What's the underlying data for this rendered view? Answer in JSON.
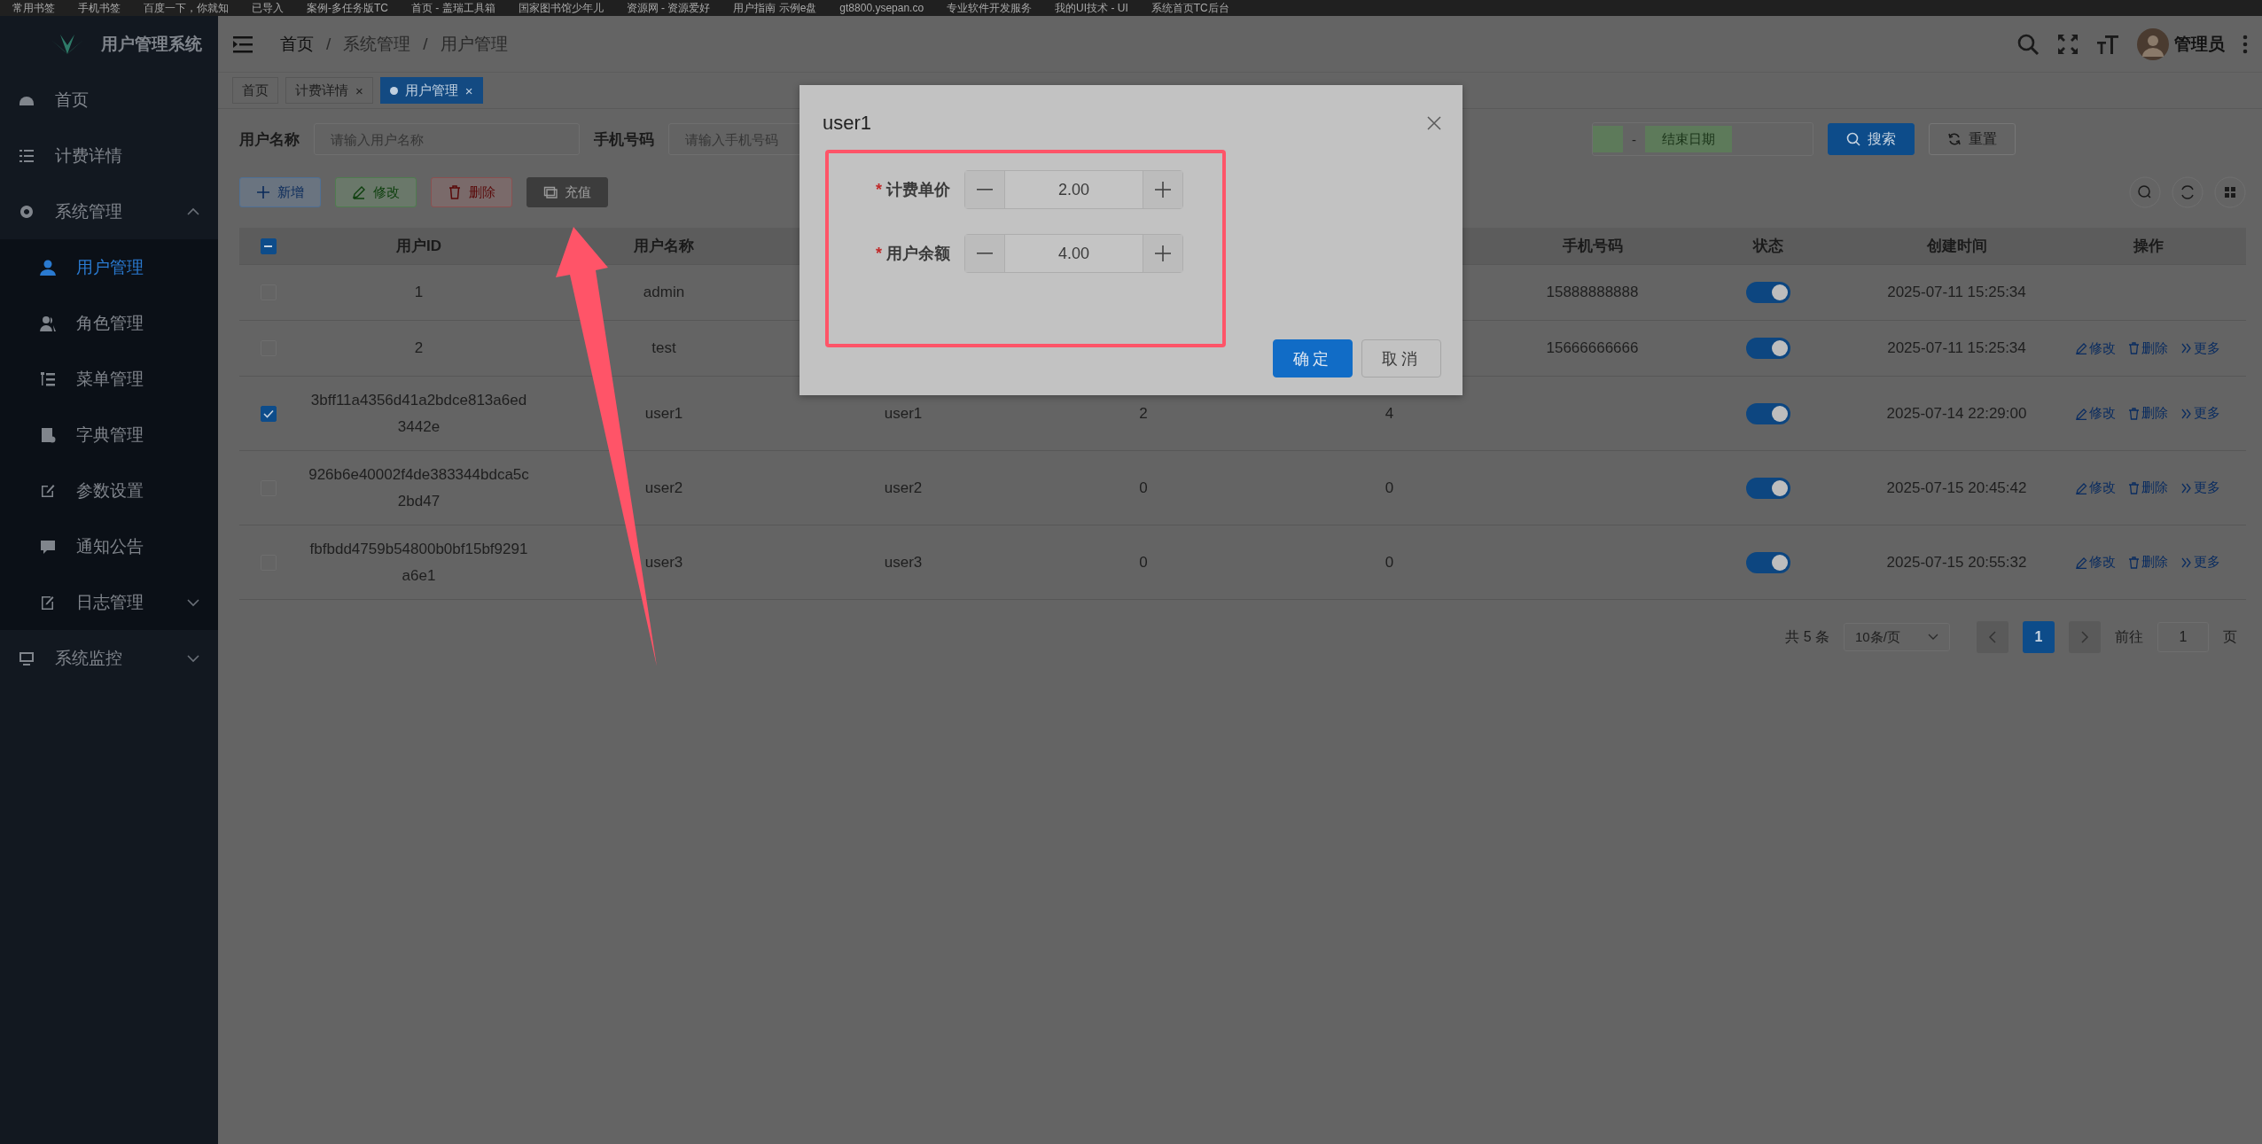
{
  "bookmarks": [
    "常用书签",
    "手机书签",
    "百度一下，你就知",
    "已导入",
    "案例-多任务版TC",
    "首页 - 盖瑞工具箱",
    "国家图书馆少年儿",
    "资源网 - 资源爱好",
    "用户指南 示例e盘",
    "gt8800.ysepan.co",
    "专业软件开发服务",
    "我的UI技术 - UI",
    "系统首页TC后台"
  ],
  "sidebar": {
    "title": "用户管理系统",
    "items": [
      {
        "label": "首页",
        "selected": false
      },
      {
        "label": "计费详情",
        "selected": false
      },
      {
        "label": "系统管理",
        "selected": false,
        "expanded": true,
        "children": [
          {
            "label": "用户管理",
            "selected": true
          },
          {
            "label": "角色管理",
            "selected": false
          },
          {
            "label": "菜单管理",
            "selected": false
          },
          {
            "label": "字典管理",
            "selected": false
          },
          {
            "label": "参数设置",
            "selected": false
          },
          {
            "label": "通知公告",
            "selected": false
          },
          {
            "label": "日志管理",
            "selected": false,
            "expanded": false
          }
        ]
      },
      {
        "label": "系统监控",
        "selected": false,
        "expanded": false
      }
    ]
  },
  "header": {
    "breadcrumb": [
      {
        "label": "首页"
      },
      {
        "separator": "/",
        "label": "系统管理"
      },
      {
        "separator": "/",
        "label": "用户管理"
      }
    ],
    "user": "管理员"
  },
  "tabs": [
    {
      "label": "首页",
      "selected": false
    },
    {
      "label": "计费详情",
      "selected": false,
      "close": "×"
    },
    {
      "label": "用户管理",
      "selected": true,
      "close": "×"
    }
  ],
  "search_form": {
    "fields": [
      {
        "label": "用户名称",
        "placeholder": "请输入用户名称"
      },
      {
        "label": "手机号码",
        "placeholder": "请输入手机号码"
      }
    ],
    "date_separator": "-",
    "date_end_placeholder": "结束日期",
    "buttons": [
      {
        "label": "搜索",
        "kind": "primary"
      },
      {
        "label": "重置",
        "kind": "default"
      }
    ]
  },
  "toolbar": [
    {
      "label": "新增",
      "kind": "add"
    },
    {
      "label": "修改",
      "kind": "edit"
    },
    {
      "label": "删除",
      "kind": "delete"
    },
    {
      "label": "充值",
      "kind": "recharge"
    }
  ],
  "table": {
    "header_checkbox": {
      "indeterminate": true
    },
    "columns": {
      "id": "用户ID",
      "name": "用户名称",
      "phone": "手机号码",
      "status": "状态",
      "created": "创建时间",
      "actions": "操作"
    },
    "rows": [
      {
        "checked": false,
        "id": "1",
        "name": "admin",
        "phone": "15888888888",
        "status_on": true,
        "created": "2025-07-11 15:25:34"
      },
      {
        "checked": false,
        "id": "2",
        "name": "test",
        "phone": "15666666666",
        "status_on": true,
        "created": "2025-07-11 15:25:34",
        "actions": [
          {
            "kind": "edit",
            "label": "修改"
          },
          {
            "kind": "delete",
            "label": "删除"
          },
          {
            "kind": "more",
            "label": "更多"
          }
        ]
      },
      {
        "checked": true,
        "id": "3bff11a4356d41a2bdce813a6ed3442e",
        "name": "user1",
        "column_3": "user1",
        "column_4": "2",
        "column_5": "4",
        "status_on": true,
        "created": "2025-07-14 22:29:00",
        "actions": [
          {
            "kind": "edit",
            "label": "修改"
          },
          {
            "kind": "delete",
            "label": "删除"
          },
          {
            "kind": "more",
            "label": "更多"
          }
        ]
      },
      {
        "checked": false,
        "id": "926b6e40002f4de383344bdca5c2bd47",
        "name": "user2",
        "column_3": "user2",
        "column_4": "0",
        "column_5": "0",
        "status_on": true,
        "created": "2025-07-15 20:45:42",
        "actions": [
          {
            "kind": "edit",
            "label": "修改"
          },
          {
            "kind": "delete",
            "label": "删除"
          },
          {
            "kind": "more",
            "label": "更多"
          }
        ]
      },
      {
        "checked": false,
        "id": "fbfbdd4759b54800b0bf15bf9291a6e1",
        "name": "user3",
        "column_3": "user3",
        "column_4": "0",
        "column_5": "0",
        "status_on": true,
        "created": "2025-07-15 20:55:32",
        "actions": [
          {
            "kind": "edit",
            "label": "修改"
          },
          {
            "kind": "delete",
            "label": "删除"
          },
          {
            "kind": "more",
            "label": "更多"
          }
        ]
      }
    ]
  },
  "pagination": {
    "total": "共 5 条",
    "page_size": "10条/页",
    "pages": [
      {
        "label": "1",
        "selected": true
      }
    ],
    "goto_label": "前往",
    "goto_value": "1",
    "goto_suffix": "页"
  },
  "dialog": {
    "title": "user1",
    "fields": [
      {
        "label": "计费单价",
        "required_mark": "*",
        "value": "2.00"
      },
      {
        "label": "用户余额",
        "required_mark": "*",
        "value": "4.00"
      }
    ],
    "buttons": [
      {
        "label": "确定",
        "kind": "primary"
      },
      {
        "label": "取消",
        "kind": "default"
      }
    ]
  }
}
